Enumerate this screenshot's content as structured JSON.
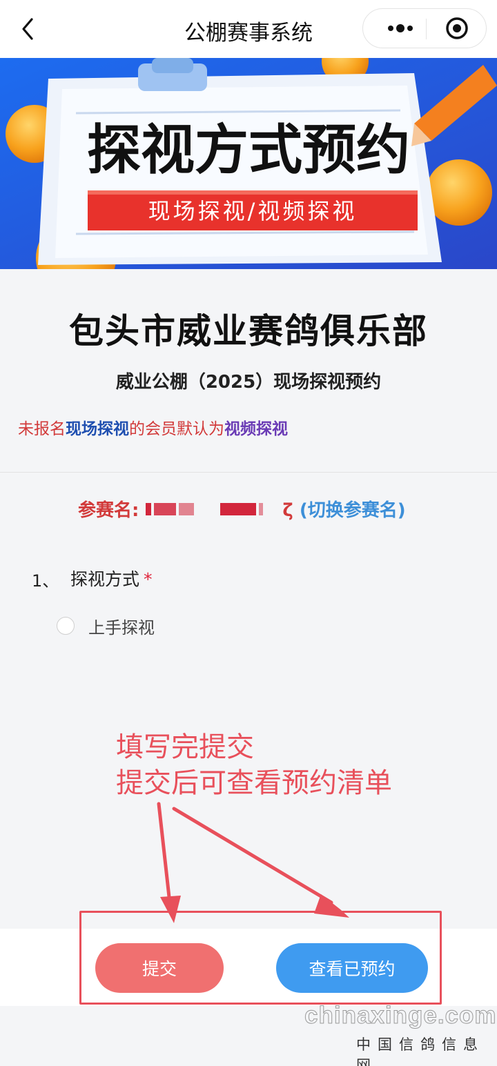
{
  "nav": {
    "title": "公棚赛事系统"
  },
  "banner": {
    "headline": "探视方式预约",
    "ribbon": "现场探视/视频探视"
  },
  "club_name": "包头市威业赛鸽俱乐部",
  "subtitle": "威业公棚（2025）现场探视预约",
  "notice": {
    "part1": "未报名",
    "part2": "现场探视",
    "part3": "的会员默认为",
    "part4": "视频探视"
  },
  "entrant": {
    "label": "参赛名:",
    "tail": "ζ",
    "switch_label": "(切换参赛名)"
  },
  "question": {
    "number": "1、",
    "text": "探视方式",
    "required_mark": "*",
    "options": [
      "上手探视"
    ]
  },
  "annotation": {
    "line1": "填写完提交",
    "line2": "提交后可查看预约清单"
  },
  "buttons": {
    "submit": "提交",
    "view": "查看已预约"
  },
  "watermark": {
    "domain": "chinaxinge.com",
    "cn": "中国信鸽信息网"
  },
  "colors": {
    "accent_red": "#e8505b",
    "submit_bg": "#f07070",
    "view_bg": "#3f9bf0",
    "link_blue": "#3d8fd8"
  }
}
